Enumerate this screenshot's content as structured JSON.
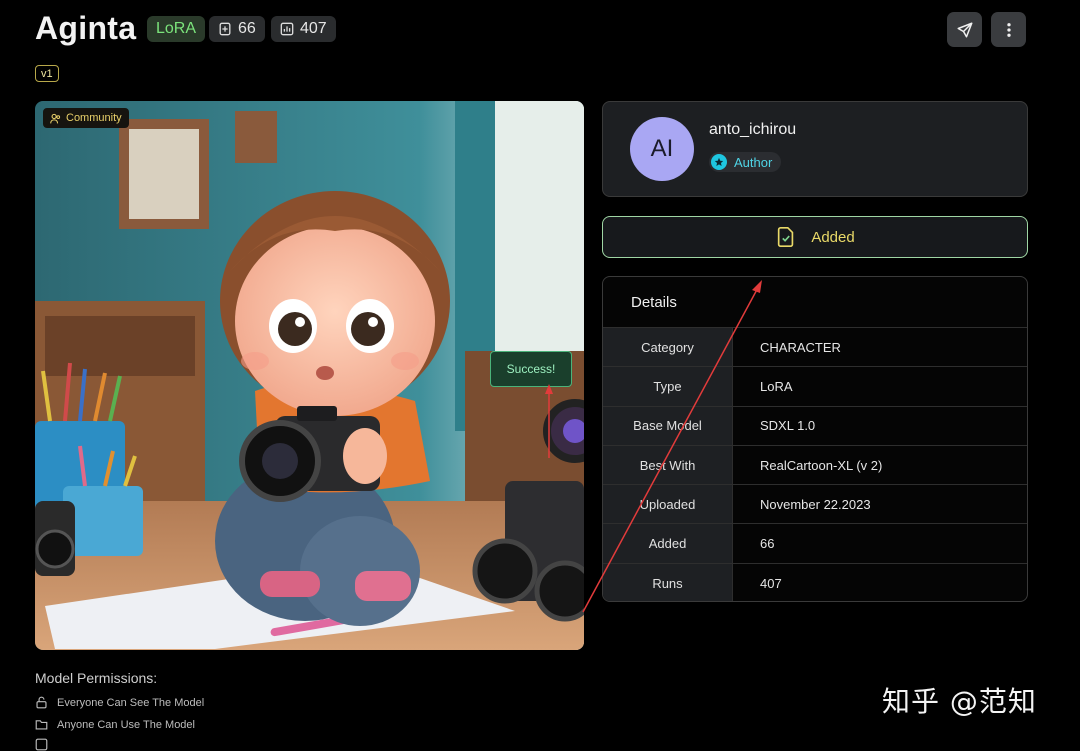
{
  "header": {
    "title": "Aginta",
    "type_badge": "LoRA",
    "added_count": "66",
    "runs_count": "407",
    "version": "v1"
  },
  "image": {
    "community_label": "Community",
    "toast": "Success!"
  },
  "author": {
    "avatar_initials": "AI",
    "username": "anto_ichirou",
    "badge": "Author"
  },
  "added_button": {
    "label": "Added"
  },
  "details": {
    "heading": "Details",
    "rows": [
      {
        "key": "Category",
        "value": "CHARACTER"
      },
      {
        "key": "Type",
        "value": "LoRA"
      },
      {
        "key": "Base Model",
        "value": "SDXL 1.0"
      },
      {
        "key": "Best With",
        "value": "RealCartoon-XL (v 2)"
      },
      {
        "key": "Uploaded",
        "value": "November 22.2023"
      },
      {
        "key": "Added",
        "value": "66"
      },
      {
        "key": "Runs",
        "value": "407"
      }
    ]
  },
  "permissions": {
    "title": "Model Permissions:",
    "items": [
      "Everyone Can See The Model",
      "Anyone Can Use The Model"
    ]
  },
  "watermark": "知乎 @范知",
  "colors": {
    "accent_green": "#7be37b",
    "author_cyan": "#4fd4e6",
    "added_yellow": "#e9d968",
    "success_green": "#4bb37a"
  }
}
